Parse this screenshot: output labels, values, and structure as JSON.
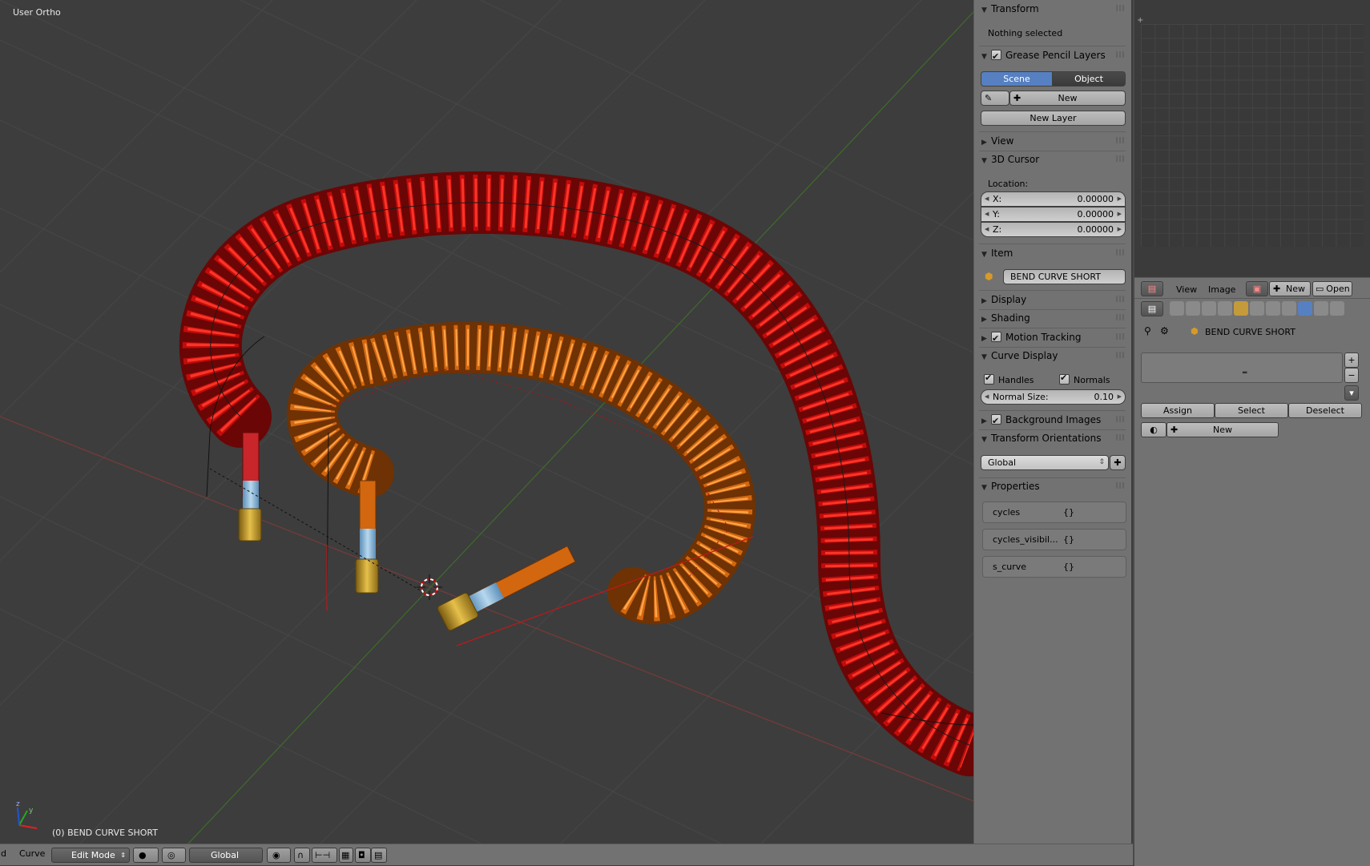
{
  "viewport": {
    "view_label": "User Ortho",
    "object_label": "(0) BEND CURVE SHORT"
  },
  "header": {
    "truncated_left": "d",
    "menu_curve": "Curve",
    "mode": "Edit Mode",
    "orientation": "Global"
  },
  "npanel": {
    "transform": {
      "title": "Transform",
      "status": "Nothing selected"
    },
    "grease_pencil": {
      "title": "Grease Pencil Layers",
      "tab_scene": "Scene",
      "tab_object": "Object",
      "new_label": "New",
      "new_layer_label": "New Layer"
    },
    "view": {
      "title": "View"
    },
    "cursor": {
      "title": "3D Cursor",
      "location_label": "Location:",
      "x_label": "X:",
      "x": "0.00000",
      "y_label": "Y:",
      "y": "0.00000",
      "z_label": "Z:",
      "z": "0.00000"
    },
    "item": {
      "title": "Item",
      "name": "BEND CURVE SHORT"
    },
    "display": {
      "title": "Display"
    },
    "shading": {
      "title": "Shading"
    },
    "motion_tracking": {
      "title": "Motion Tracking"
    },
    "curve_display": {
      "title": "Curve Display",
      "handles": "Handles",
      "normals": "Normals",
      "normal_size_label": "Normal Size:",
      "normal_size": "0.10"
    },
    "background_images": {
      "title": "Background Images"
    },
    "transform_orientations": {
      "title": "Transform Orientations",
      "value": "Global"
    },
    "properties": {
      "title": "Properties",
      "items": [
        {
          "name": "cycles",
          "value": "{}"
        },
        {
          "name": "cycles_visibil...",
          "value": "{}"
        },
        {
          "name": "s_curve",
          "value": "{}"
        }
      ]
    }
  },
  "image_editor": {
    "menu_view": "View",
    "menu_image": "Image",
    "new_label": "New",
    "open_label": "Open"
  },
  "properties_editor": {
    "object_name": "BEND CURVE SHORT",
    "assign": "Assign",
    "select": "Select",
    "deselect": "Deselect",
    "new_material": "New"
  },
  "colors": {
    "red_coil": "#d10d0d",
    "orange_coil": "#d2670f",
    "viewport_bg": "#3d3d3d",
    "panel_bg": "#727272",
    "tab_active": "#5680c2"
  }
}
